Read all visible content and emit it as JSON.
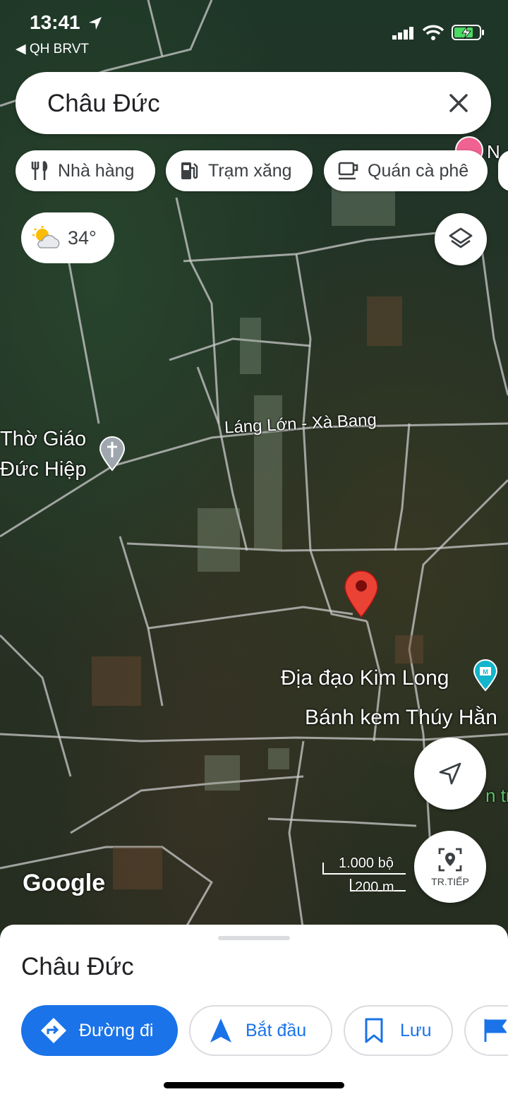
{
  "status": {
    "time": "13:41",
    "carrier": "◀ QH BRVT"
  },
  "search": {
    "query": "Châu Đức"
  },
  "chips": [
    {
      "label": "Nhà hàng",
      "icon": "restaurant-icon"
    },
    {
      "label": "Trạm xăng",
      "icon": "gas-station-icon"
    },
    {
      "label": "Quán cà phê",
      "icon": "coffee-icon"
    }
  ],
  "weather": {
    "temp": "34°"
  },
  "map": {
    "road_label": "Láng Lớn - Xà Bang",
    "poi_left_1": "Thờ Giáo",
    "poi_left_2": "Đức Hiệp",
    "poi_kimlong": "Địa đạo Kim Long",
    "poi_bakery": "Bánh kem Thúy Hằn",
    "partial_top_right": "N",
    "partial_right": "n tr",
    "google_logo": "Google",
    "scale_ft": "1.000 bộ",
    "scale_m": "200 m"
  },
  "live_view": {
    "label": "TR.TIẾP"
  },
  "sheet": {
    "title": "Châu Đức",
    "actions": {
      "directions": "Đường đi",
      "start": "Bắt đầu",
      "save": "Lưu"
    }
  },
  "colors": {
    "accent": "#1a73e8",
    "pin": "#ea4335"
  }
}
